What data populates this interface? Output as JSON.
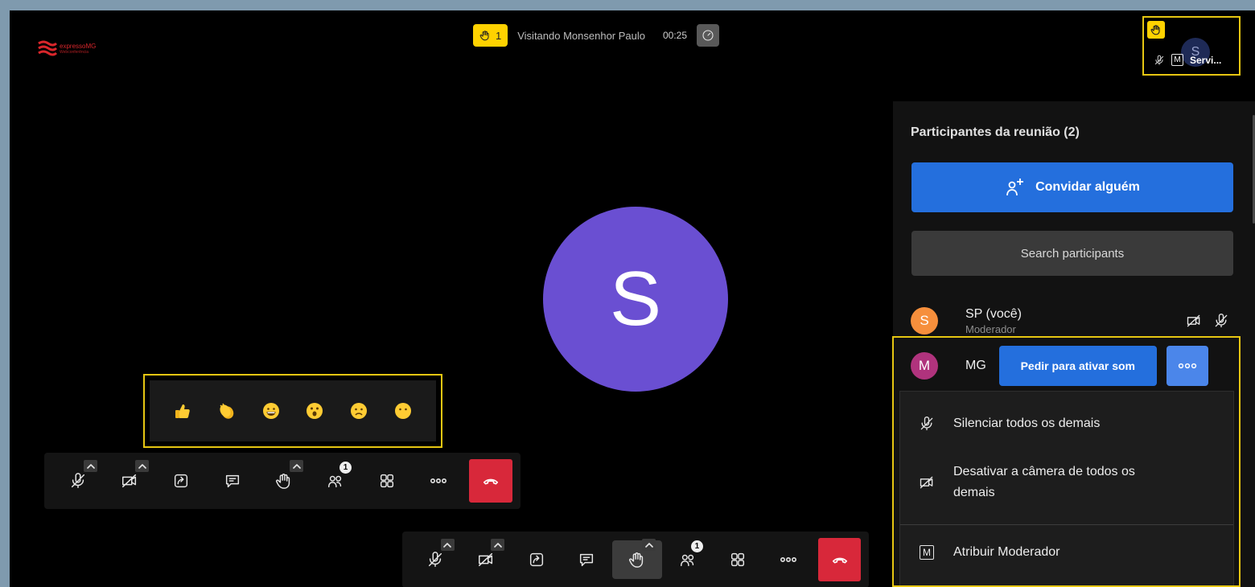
{
  "logo": {
    "text": "expressoMG",
    "sub": "Webconferência"
  },
  "topbar": {
    "raised_hands_count": "1",
    "meeting_title": "Visitando Monsenhor Paulo",
    "timer": "00:25"
  },
  "mini_tile": {
    "avatar_letter": "S",
    "moderator_badge": "M",
    "name": "Servi..."
  },
  "main_avatar": {
    "letter": "S",
    "color": "#6a4fd2"
  },
  "reactions": [
    "thumbs-up",
    "clapping-hands",
    "grinning-face",
    "surprised-face",
    "frowning-face",
    "neutral-face"
  ],
  "toolbar": {
    "participants_badge": "1"
  },
  "panel": {
    "title": "Participantes da reunião (2)",
    "invite_label": "Convidar alguém",
    "search_placeholder": "Search participants",
    "participants": [
      {
        "initial": "S",
        "name": "SP (você)",
        "role": "Moderador",
        "color": "#f68f3c"
      },
      {
        "initial": "M",
        "name": "MG",
        "action": "Pedir para ativar som",
        "color": "#b0337d"
      }
    ],
    "menu": {
      "mute_all": "Silenciar todos os demais",
      "disable_cameras_line1": "Desativar a câmera de todos os",
      "disable_cameras_line2": "demais",
      "moderator_badge": "M",
      "grant_moderator": "Atribuir Moderador"
    }
  },
  "colors": {
    "accent_blue": "#246fdd",
    "highlight_yellow": "#e6c612",
    "hangup_red": "#d8283a",
    "hand_yellow": "#ffd200"
  }
}
